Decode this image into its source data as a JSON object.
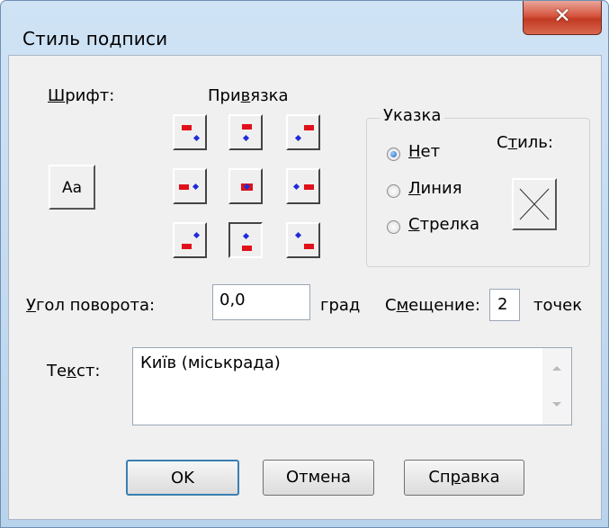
{
  "window": {
    "title": "Стиль подписи"
  },
  "font": {
    "label_pre": "",
    "label_u": "Ш",
    "label_post": "рифт:",
    "button_label": "Аа"
  },
  "anchor": {
    "label_pre": "При",
    "label_u": "в",
    "label_post": "язка",
    "selected_index": 7
  },
  "leader": {
    "group_label": "Указка",
    "options": [
      {
        "u": "Н",
        "rest": "ет",
        "checked": true
      },
      {
        "u": "Л",
        "rest": "иния",
        "checked": false
      },
      {
        "u": "С",
        "rest": "трелка",
        "checked": false
      }
    ],
    "style_label_pre": "С",
    "style_label_u": "т",
    "style_label_post": "иль:"
  },
  "rotation": {
    "label_u": "У",
    "label_post": "гол поворота:",
    "value": "0,0",
    "unit": "град"
  },
  "offset": {
    "label_pre": "С",
    "label_u": "м",
    "label_post": "ещение:",
    "value": "2",
    "unit": "точек"
  },
  "text": {
    "label_pre": "Те",
    "label_u": "к",
    "label_post": "ст:",
    "value": "Київ  (міськрада)"
  },
  "buttons": {
    "ok": "OK",
    "cancel": "Отмена",
    "help_pre": "Сп",
    "help_u": "р",
    "help_post": "авка"
  },
  "colors": {
    "red_marker": "#e0111a",
    "blue_marker": "#1f2bd8",
    "ok_border": "#3c7fb1"
  }
}
